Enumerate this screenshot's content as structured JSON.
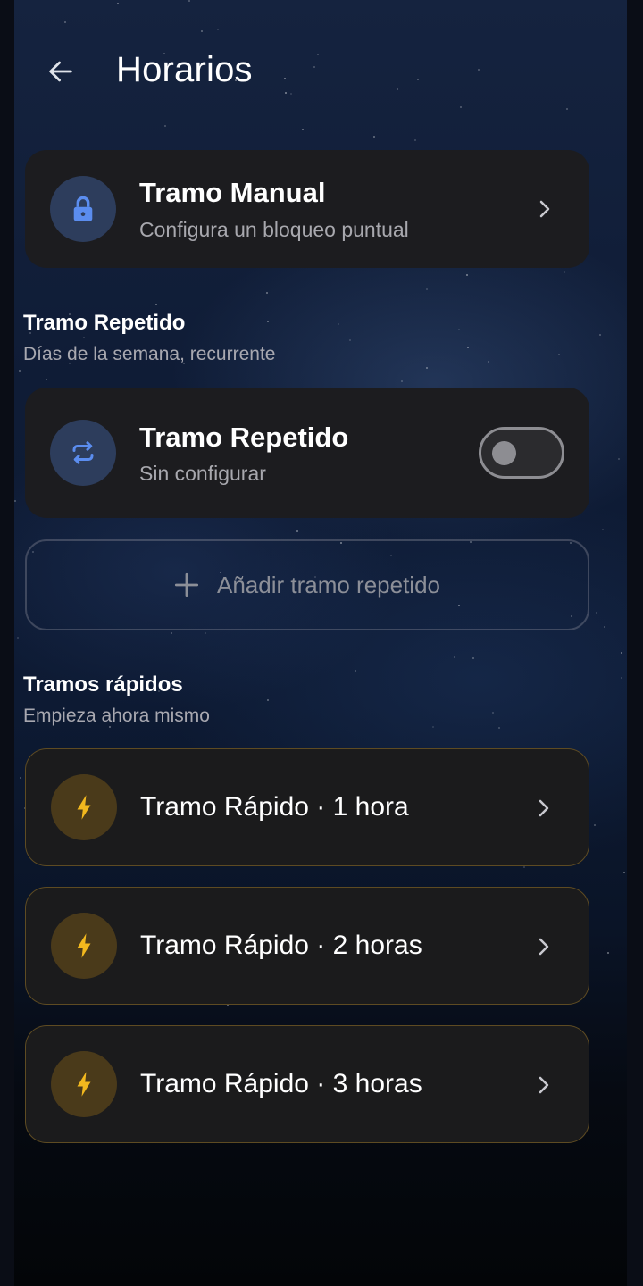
{
  "header": {
    "title": "Horarios"
  },
  "manual": {
    "title": "Tramo Manual",
    "subtitle": "Configura un bloqueo puntual",
    "icon": "lock-icon"
  },
  "repeated_section": {
    "title": "Tramo Repetido",
    "subtitle": "Días de la semana, recurrente"
  },
  "repeated_card": {
    "title": "Tramo Repetido",
    "subtitle": "Sin configurar",
    "enabled": false,
    "icon": "repeat-icon"
  },
  "add_repeated": {
    "label": "Añadir tramo repetido"
  },
  "quick_section": {
    "title": "Tramos rápidos",
    "subtitle": "Empieza ahora mismo"
  },
  "quick_items": [
    {
      "label": "Tramo Rápido · 1 hora"
    },
    {
      "label": "Tramo Rápido · 2 horas"
    },
    {
      "label": "Tramo Rápido · 3 horas"
    }
  ],
  "colors": {
    "card_bg": "#1c1c1f",
    "blue_icon_bg": "#2d3d5c",
    "blue_accent": "#5b8def",
    "gold_icon_bg": "#4a3a1a",
    "gold_accent": "#f2b81e",
    "quick_border": "#967328"
  }
}
